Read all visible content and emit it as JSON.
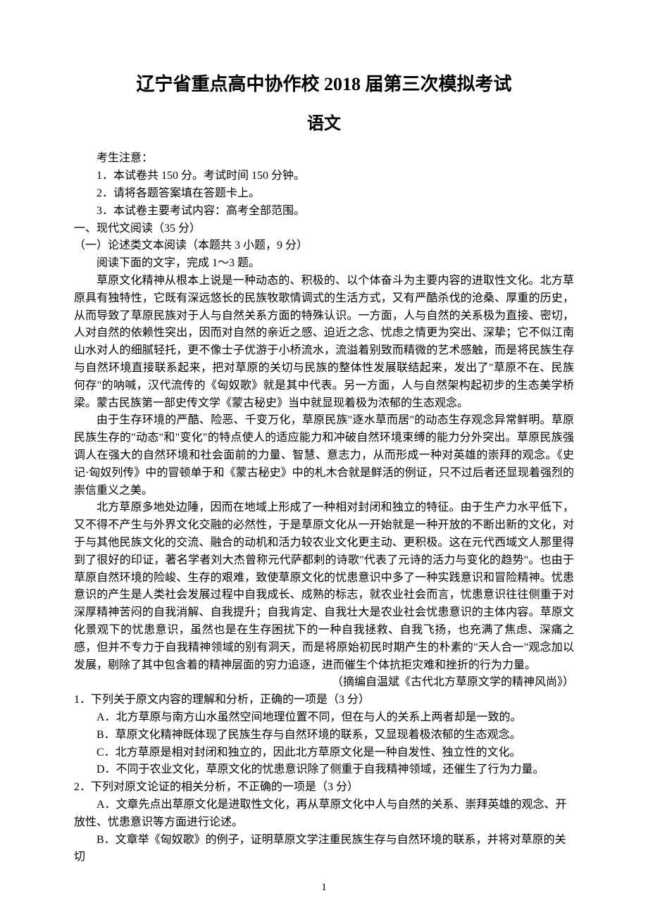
{
  "header": {
    "title_main": "辽宁省重点高中协作校 2018 届第三次模拟考试",
    "title_sub": "语文"
  },
  "notice": {
    "label": "考生注意：",
    "items": [
      "1．本试卷共 150 分。考试时间 150 分钟。",
      "2．请将各题答案填在答题卡上。",
      "3．本试卷主要考试内容：高考全部范围。"
    ]
  },
  "section": {
    "heading": "一、现代文阅读（35 分）",
    "subheading": "（一）论述类文本阅读（本题共 3 小题，9 分）",
    "instruction": "阅读下面的文字，完成 1～3 题。",
    "paragraphs": [
      "草原文化精神从根本上说是一种动态的、积极的、以个体奋斗为主要内容的进取性文化。北方草原具有独特性，它既有深远悠长的民族牧歌情调式的生活方式，又有严酷杀伐的沧桑、厚重的历史，从而导致了草原民族对于人与自然关系方面的特殊认识。一方面，人与自然的关系极为直接、密切，人对自然的依赖性突出，因而对自然的亲近之感、迫近之念、忧虑之情更为突出、深挚；它不似江南山水对人的细腻轻托，更不像士子优游于小桥流水，流溢着别致而精微的艺术感触，而是将民族生存与自然环境直接联系起来，把对草原的关切与民族的整体性发展联结起来，发出了\"草原不在、民族何存\"的呐喊，汉代流传的《匈奴歌》就是其中代表。另一方面，人与自然架构起初步的生态美学桥梁。蒙古民族第一部史传文学《蒙古秘史》当中就显现着极为浓郁的生态观念。",
      "由于生存环境的严酷、险恶、千变万化，草原民族\"逐水草而居\"的动态生存观念异常鲜明。草原民族生存的\"动态\"和\"变化\"的特点使人的适应能力和冲破自然环境束缚的能力分外突出。草原民族强调人在强大的自然环境和社会面前的力量、智慧、意志力，从而形成一种对英雄的崇拜的观念。《史记·匈奴列传》中的冒顿单于和《蒙古秘史》中的札木合就是鲜活的例证，只不过后者还显现着强烈的崇信重义之美。",
      "北方草原多地处边陲，因而在地域上形成了一种相对封闭和独立的特征。由于生产力水平低下，又不得不产生与外界文化交融的必然性，于是草原文化从一开始就是一种开放的不断出新的文化，对于与其他民族文化的交流、融合的动机和活力较农业文化更主动、更积极。这在元代西域文人那里得到了很好的印证，著名学者刘大杰曾称元代萨都剌的诗歌\"代表了元诗的活力与变化的趋势\"。也由于草原自然环境的险峻、生存的艰难，致使草原文化的忧患意识中多了一种实践意识和冒险精神。忧患意识的产生是人类社会发展过程中自我成长、成熟的标志，就农业社会而言，忧患意识往往侧重于对深厚精神苦闷的自我消解、自我提升；自我肯定、自我壮大是农业社会忧患意识的主体内容。草原文化景观下的忧患意识，虽然也是在生存困扰下的一种自我拯救、自我飞扬，也充满了焦虑、深痛之感，但并不专力于自我精神领域的别有洞天，而是将原始初民时期产生的朴素的\"天人合一\"观念加以发展，剔除了其中包含着的精神层面的穷力追逐，进而催生个体抗拒灾难和挫折的行为力量。"
    ],
    "citation": "（摘编自温斌《古代北方草原文学的精神风尚》）"
  },
  "questions": {
    "q1": {
      "stem": "1．下列关于原文内容的理解和分析，正确的一项是（3 分）",
      "options": [
        "A．北方草原与南方山水虽然空间地理位置不同，但在与人的关系上两者却是一致的。",
        "B．草原文化精神既体现了民族生存与自然环境的联系，又显现着极浓郁的生态观念。",
        "C．北方草原是相对封闭和独立的，因此北方草原文化是一种自发性、独立性的文化。",
        "D．不同于农业文化，草原文化的忧患意识除了侧重于自我精神领域，还催生了行为力量。"
      ]
    },
    "q2": {
      "stem": "2．下列对原文论证的相关分析，不正确的一项是（3 分）",
      "options": [
        "A．文章先点出草原文化是进取性文化，再从草原文化中人与自然的关系、崇拜英雄的观念、开放性、忧患意识等方面进行论述。",
        "B．文章举《匈奴歌》的例子，证明草原文学注重民族生存与自然环境的联系，并将对草原的关切"
      ]
    }
  },
  "page_number": "1"
}
